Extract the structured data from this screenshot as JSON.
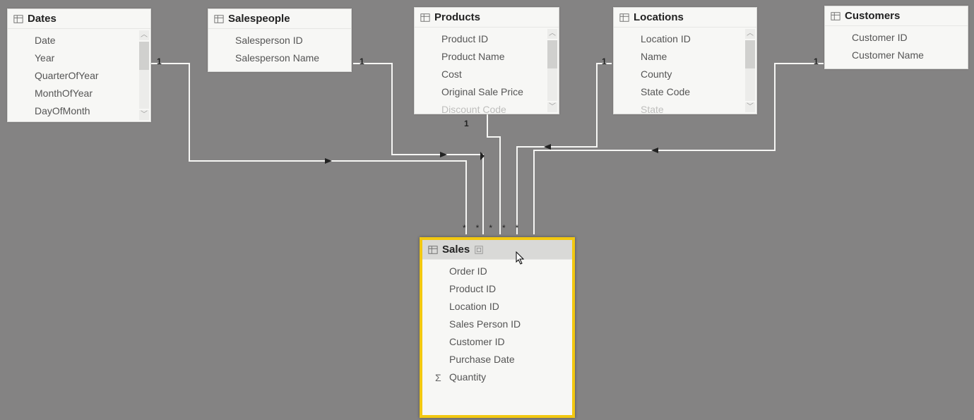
{
  "tables": {
    "dates": {
      "name": "Dates",
      "fields": [
        "Date",
        "Year",
        "QuarterOfYear",
        "MonthOfYear",
        "DayOfMonth"
      ]
    },
    "salespeople": {
      "name": "Salespeople",
      "fields": [
        "Salesperson ID",
        "Salesperson Name"
      ]
    },
    "products": {
      "name": "Products",
      "fields": [
        "Product ID",
        "Product Name",
        "Cost",
        "Original Sale Price",
        "Discount Code"
      ]
    },
    "locations": {
      "name": "Locations",
      "fields": [
        "Location ID",
        "Name",
        "County",
        "State Code",
        "State"
      ]
    },
    "customers": {
      "name": "Customers",
      "fields": [
        "Customer ID",
        "Customer Name"
      ]
    },
    "sales": {
      "name": "Sales",
      "fields": [
        "Order ID",
        "Product ID",
        "Location ID",
        "Sales Person ID",
        "Customer ID",
        "Purchase Date",
        "Quantity"
      ]
    }
  },
  "cardinality": {
    "dates": "1",
    "salespeople": "1",
    "products": "1",
    "locations": "1",
    "customers": "1",
    "sales": "*"
  },
  "sigma_label": "Σ"
}
